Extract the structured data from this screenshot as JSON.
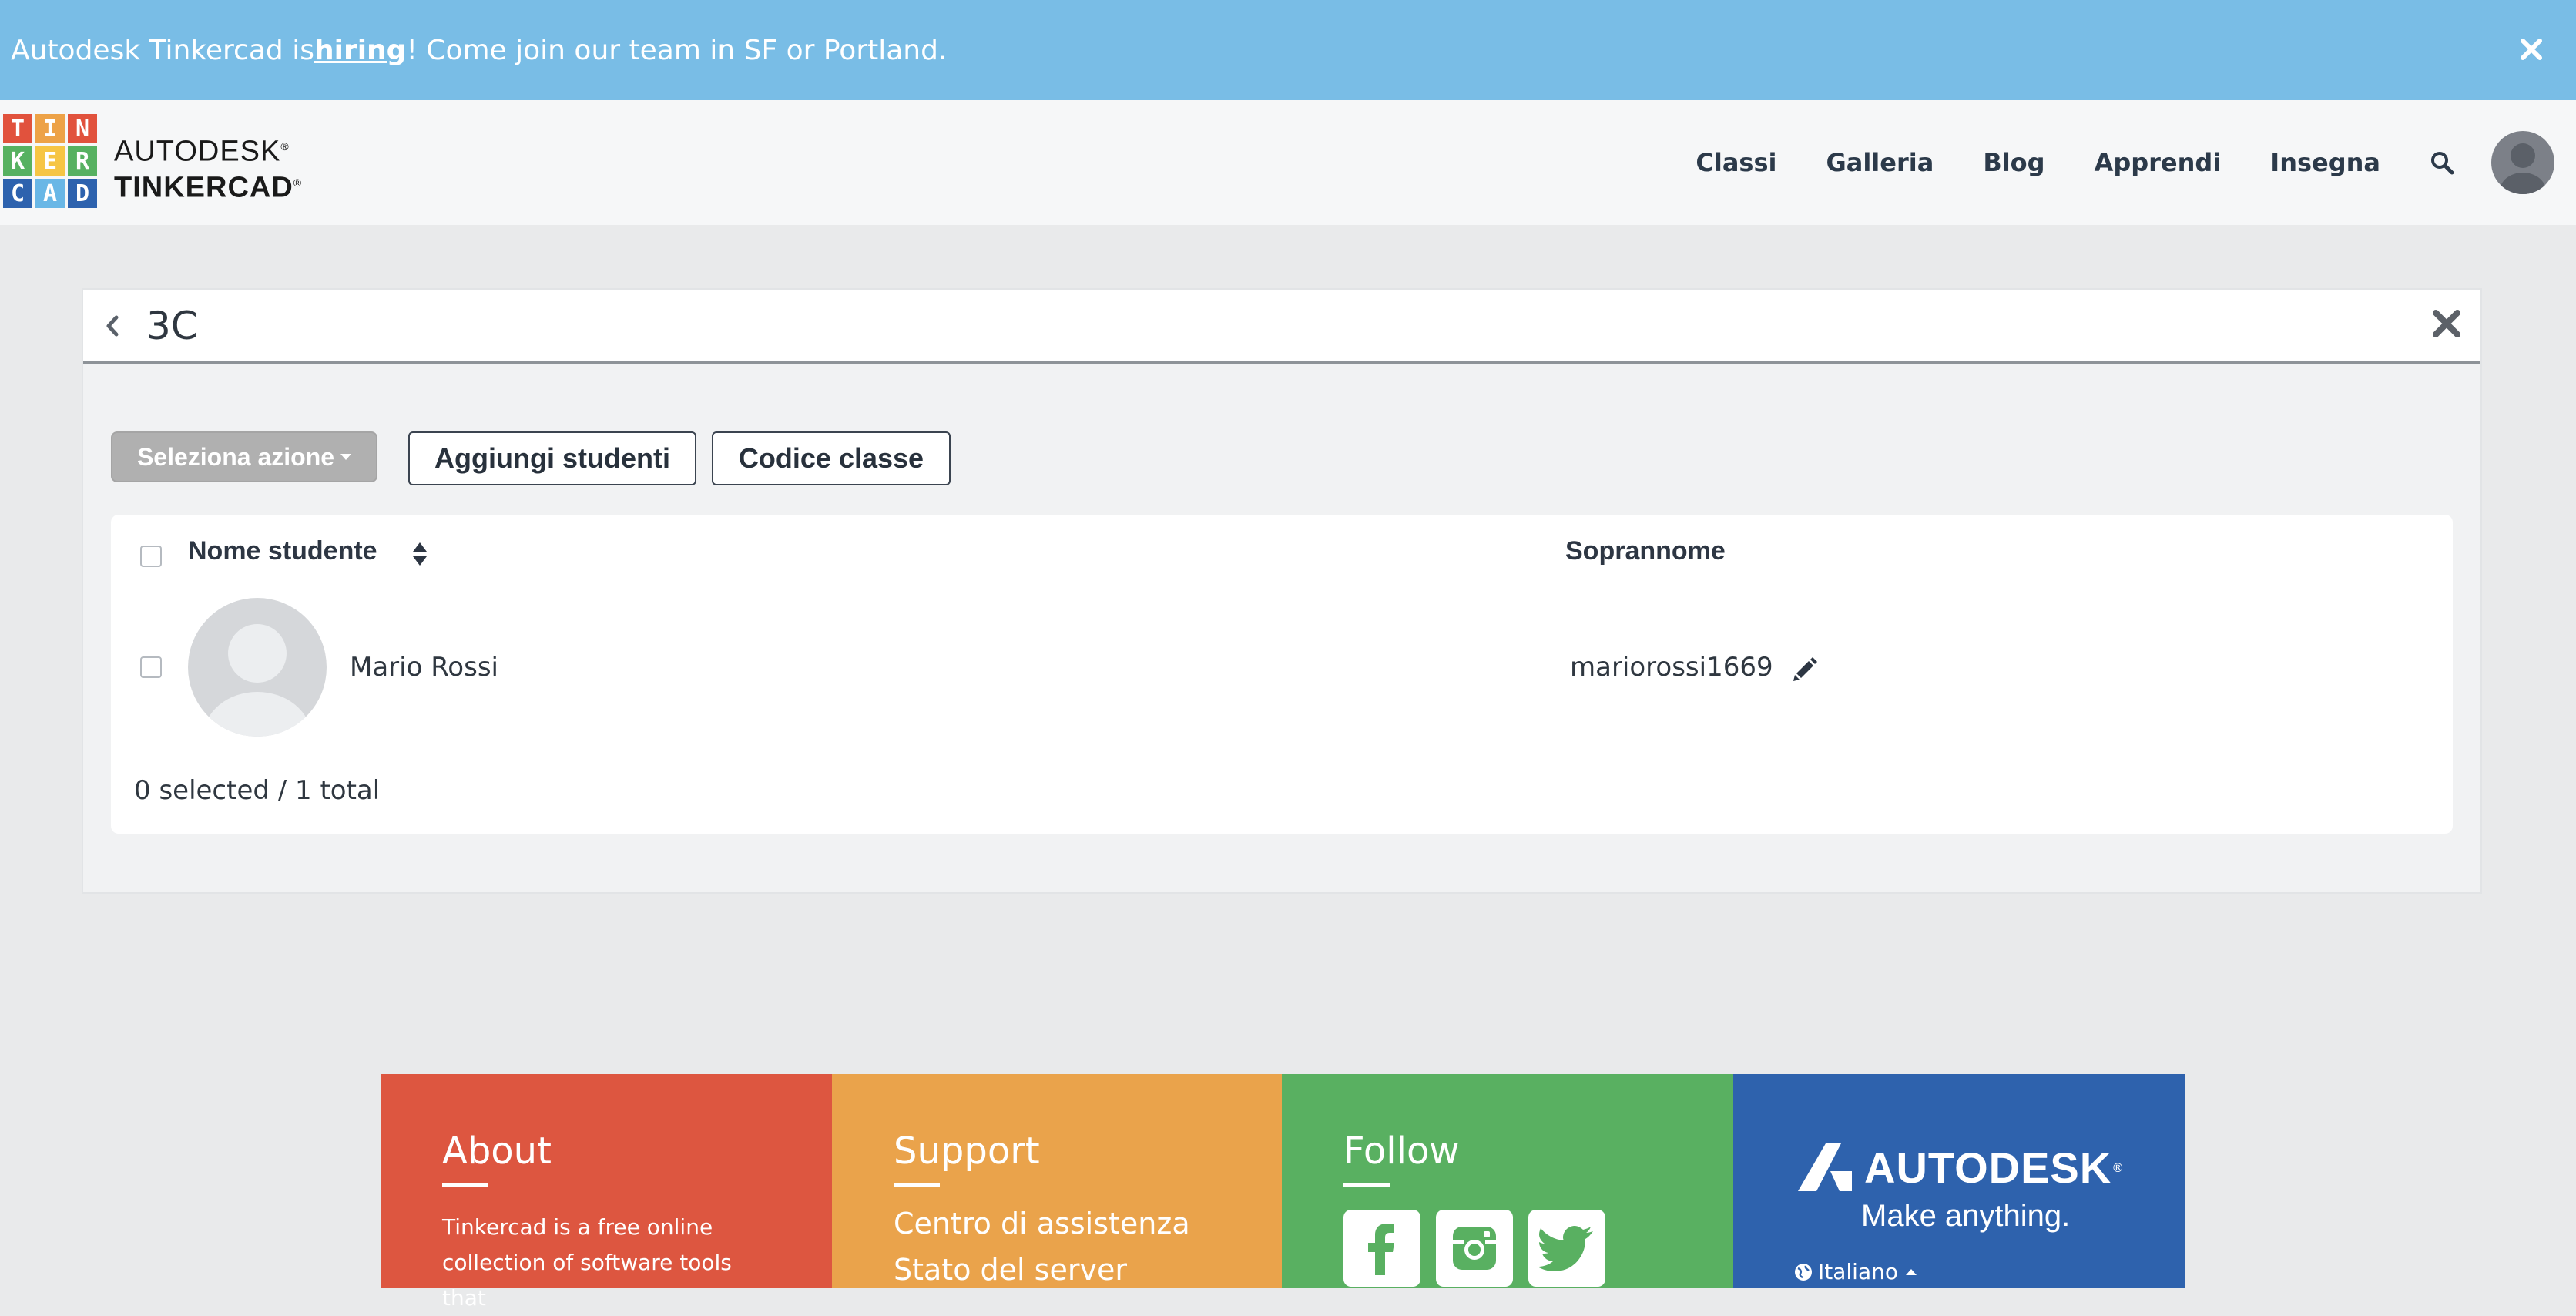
{
  "banner": {
    "text_before": "Autodesk Tinkercad is ",
    "link": "hiring",
    "text_after": "! Come join our team in SF or Portland."
  },
  "logo": {
    "tiles": [
      "T",
      "I",
      "N",
      "K",
      "E",
      "R",
      "C",
      "A",
      "D"
    ],
    "line1": "AUTODESK",
    "line2": "TINKERCAD",
    "reg": "®"
  },
  "nav": {
    "items": [
      "Classi",
      "Galleria",
      "Blog",
      "Apprendi",
      "Insegna"
    ]
  },
  "class": {
    "name": "3C"
  },
  "actions": {
    "select_action": "Seleziona azione",
    "add_students": "Aggiungi studenti",
    "class_code": "Codice classe"
  },
  "table": {
    "col_name": "Nome studente",
    "col_nickname": "Soprannome",
    "rows": [
      {
        "name": "Mario Rossi",
        "nickname": "mariorossi1669"
      }
    ],
    "summary": "0 selected / 1 total"
  },
  "footer": {
    "about": {
      "title": "About",
      "text": "Tinkercad is a free online collection of software tools that"
    },
    "support": {
      "title": "Support",
      "links": [
        "Centro di assistenza",
        "Stato del server"
      ]
    },
    "follow": {
      "title": "Follow",
      "icons": [
        "facebook-icon",
        "instagram-icon",
        "twitter-icon"
      ]
    },
    "brand": {
      "name": "AUTODESK",
      "reg": "®",
      "tagline": "Make anything.",
      "language": "Italiano"
    }
  },
  "colors": {
    "banner": "#79bde6",
    "about": "#dd5640",
    "support": "#eaa34b",
    "follow": "#59b061",
    "brand": "#2e62ad"
  }
}
